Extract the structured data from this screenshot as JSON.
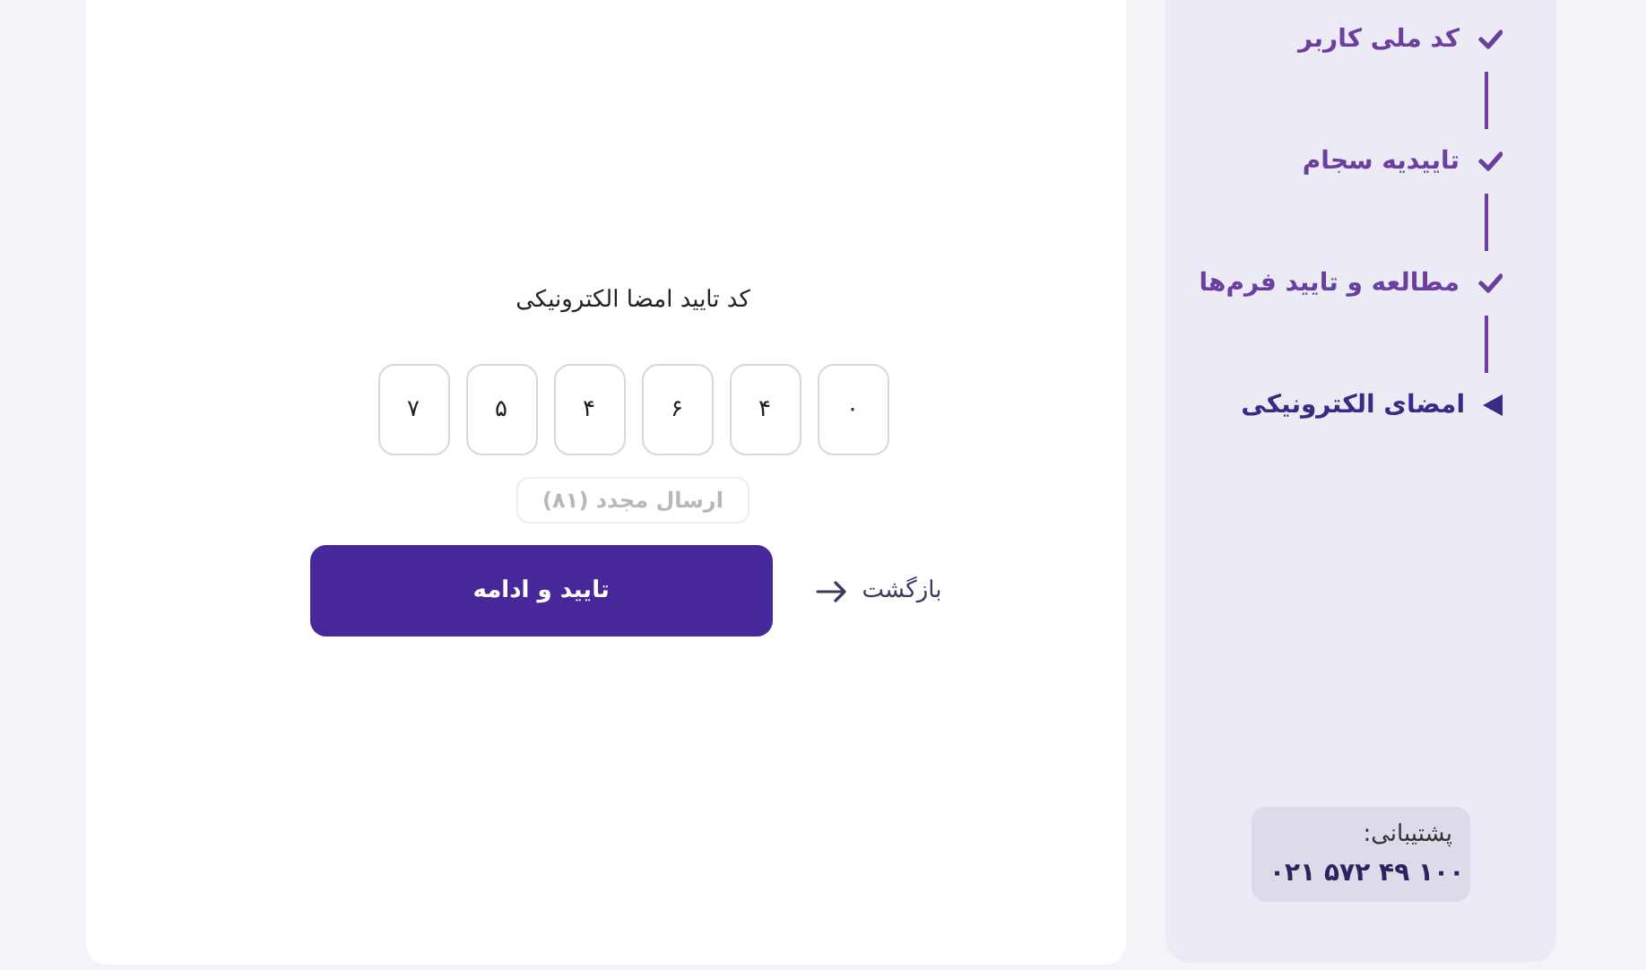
{
  "form": {
    "title": "کد تایید امضا الکترونیکی",
    "code_digits": [
      "۰",
      "۴",
      "۶",
      "۴",
      "۵",
      "۷"
    ],
    "resend": {
      "label": "ارسال مجدد (۸۱)",
      "disabled": true
    },
    "submit": "تایید و ادامه",
    "back": "بازگشت"
  },
  "steps": [
    {
      "label": "کد ملی کاربر",
      "kind": "done"
    },
    {
      "label": "تاییدیه سجام",
      "kind": "done"
    },
    {
      "label": "مطالعه و تایید فرم‌ها",
      "kind": "done"
    },
    {
      "label": "امضای الکترونیکی",
      "kind": "current"
    }
  ],
  "support": {
    "label": "پشتیبانی:",
    "phone": "۰۲۱ ۵۷۲ ۴۹ ۱۰۰"
  }
}
